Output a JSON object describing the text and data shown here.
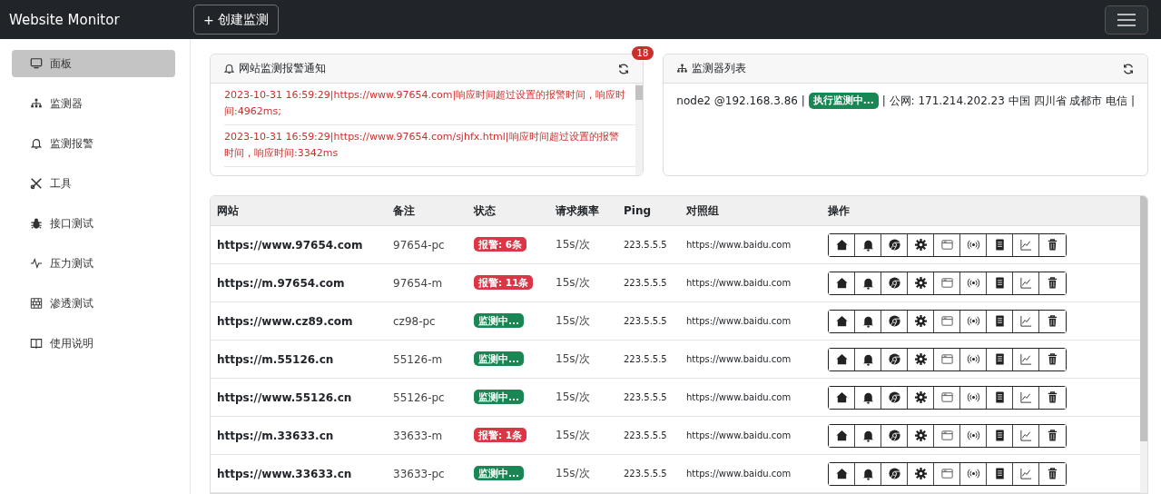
{
  "app_title": "Website Monitor",
  "create_button": {
    "icon": "+",
    "label": "创建监测"
  },
  "sidebar": {
    "items": [
      {
        "label": "面板",
        "selected": true
      },
      {
        "label": "监测器",
        "selected": false
      },
      {
        "label": "监测报警",
        "selected": false
      },
      {
        "label": "工具",
        "selected": false
      },
      {
        "label": "接口测试",
        "selected": false
      },
      {
        "label": "压力测试",
        "selected": false
      },
      {
        "label": "渗透测试",
        "selected": false
      },
      {
        "label": "使用说明",
        "selected": false
      }
    ]
  },
  "alerts_card": {
    "title": "网站监测报警通知",
    "badge": "18",
    "items": [
      "2023-10-31 16:59:29|https://www.97654.com|响应时间超过设置的报警时间，响应时间:4962ms;",
      "2023-10-31 16:59:29|https://www.97654.com/sjhfx.html|响应时间超过设置的报警时间，响应时间:3342ms"
    ]
  },
  "monitors_card": {
    "title": "监测器列表",
    "nodes": [
      {
        "name": "node2 @192.168.3.86 |",
        "status": "执行监测中...",
        "info": "| 公网: 171.214.202.23 中国 四川省 成都市 电信 |"
      }
    ]
  },
  "table": {
    "columns": [
      "网站",
      "备注",
      "状态",
      "请求频率",
      "Ping",
      "对照组",
      "操作"
    ],
    "rows": [
      {
        "site": "https://www.97654.com",
        "note": "97654-pc",
        "status": {
          "kind": "alert",
          "label": "报警: 6条"
        },
        "frequency": "15s/次",
        "ping": "223.5.5.5",
        "control": "https://www.baidu.com"
      },
      {
        "site": "https://m.97654.com",
        "note": "97654-m",
        "status": {
          "kind": "alert",
          "label": "报警: 11条"
        },
        "frequency": "15s/次",
        "ping": "223.5.5.5",
        "control": "https://www.baidu.com"
      },
      {
        "site": "https://www.cz89.com",
        "note": "cz98-pc",
        "status": {
          "kind": "monitoring",
          "label": "监测中..."
        },
        "frequency": "15s/次",
        "ping": "223.5.5.5",
        "control": "https://www.baidu.com"
      },
      {
        "site": "https://m.55126.cn",
        "note": "55126-m",
        "status": {
          "kind": "monitoring",
          "label": "监测中..."
        },
        "frequency": "15s/次",
        "ping": "223.5.5.5",
        "control": "https://www.baidu.com"
      },
      {
        "site": "https://www.55126.cn",
        "note": "55126-pc",
        "status": {
          "kind": "monitoring",
          "label": "监测中..."
        },
        "frequency": "15s/次",
        "ping": "223.5.5.5",
        "control": "https://www.baidu.com"
      },
      {
        "site": "https://m.33633.cn",
        "note": "33633-m",
        "status": {
          "kind": "alert",
          "label": "报警: 1条"
        },
        "frequency": "15s/次",
        "ping": "223.5.5.5",
        "control": "https://www.baidu.com"
      },
      {
        "site": "https://www.33633.cn",
        "note": "33633-pc",
        "status": {
          "kind": "monitoring",
          "label": "监测中..."
        },
        "frequency": "15s/次",
        "ping": "223.5.5.5",
        "control": "https://www.baidu.com"
      }
    ]
  }
}
